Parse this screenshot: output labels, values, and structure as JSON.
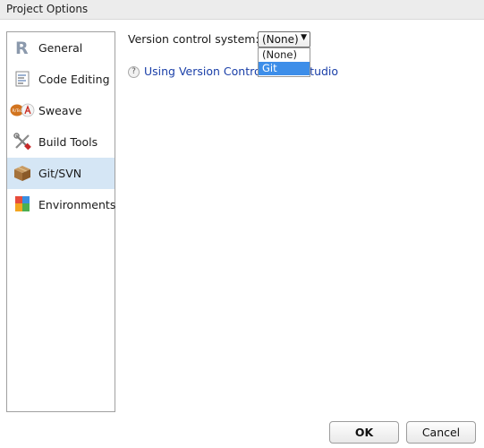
{
  "window": {
    "title": "Project Options"
  },
  "sidebar": {
    "items": [
      {
        "label": "General",
        "icon": "r-logo-icon",
        "active": false
      },
      {
        "label": "Code Editing",
        "icon": "code-editing-icon",
        "active": false
      },
      {
        "label": "Sweave",
        "icon": "sweave-pdf-icon",
        "active": false
      },
      {
        "label": "Build Tools",
        "icon": "build-tools-icon",
        "active": false
      },
      {
        "label": "Git/SVN",
        "icon": "package-box-icon",
        "active": true
      },
      {
        "label": "Environments",
        "icon": "environments-icon",
        "active": false
      }
    ]
  },
  "main": {
    "vcs_label": "Version control system:",
    "vcs_selected": "(None)",
    "vcs_options": [
      "(None)",
      "Git"
    ],
    "vcs_highlighted": "Git",
    "help_icon_glyph": "?",
    "help_link_text": "Using Version Control with RStudio"
  },
  "buttons": {
    "ok": "OK",
    "cancel": "Cancel"
  },
  "colors": {
    "selection": "#d5e6f5",
    "dropdown_highlight": "#3d8ee9",
    "link": "#1a3fa8"
  }
}
